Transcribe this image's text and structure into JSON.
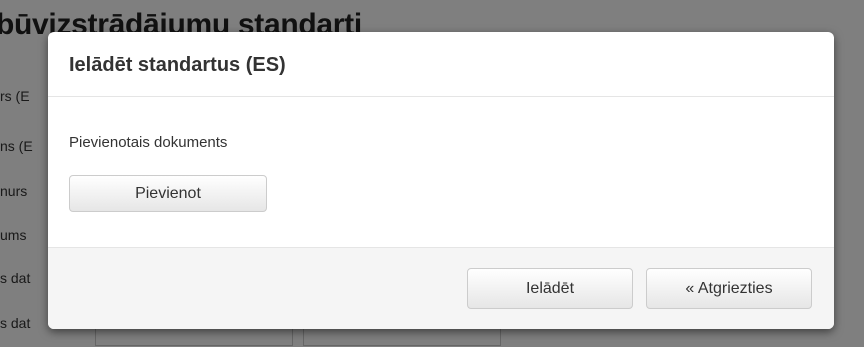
{
  "background": {
    "page_title": "būvizstrādājumu standarti",
    "rows": [
      "rs (E",
      "ns (E",
      "nurs",
      "ums",
      "s dat",
      "s dat"
    ]
  },
  "modal": {
    "title": "Ielādēt standartus (ES)",
    "attachment_label": "Pievienotais dokuments",
    "attach_button": "Pievienot",
    "load_button": "Ielādēt",
    "back_button": "« Atgriezties"
  }
}
